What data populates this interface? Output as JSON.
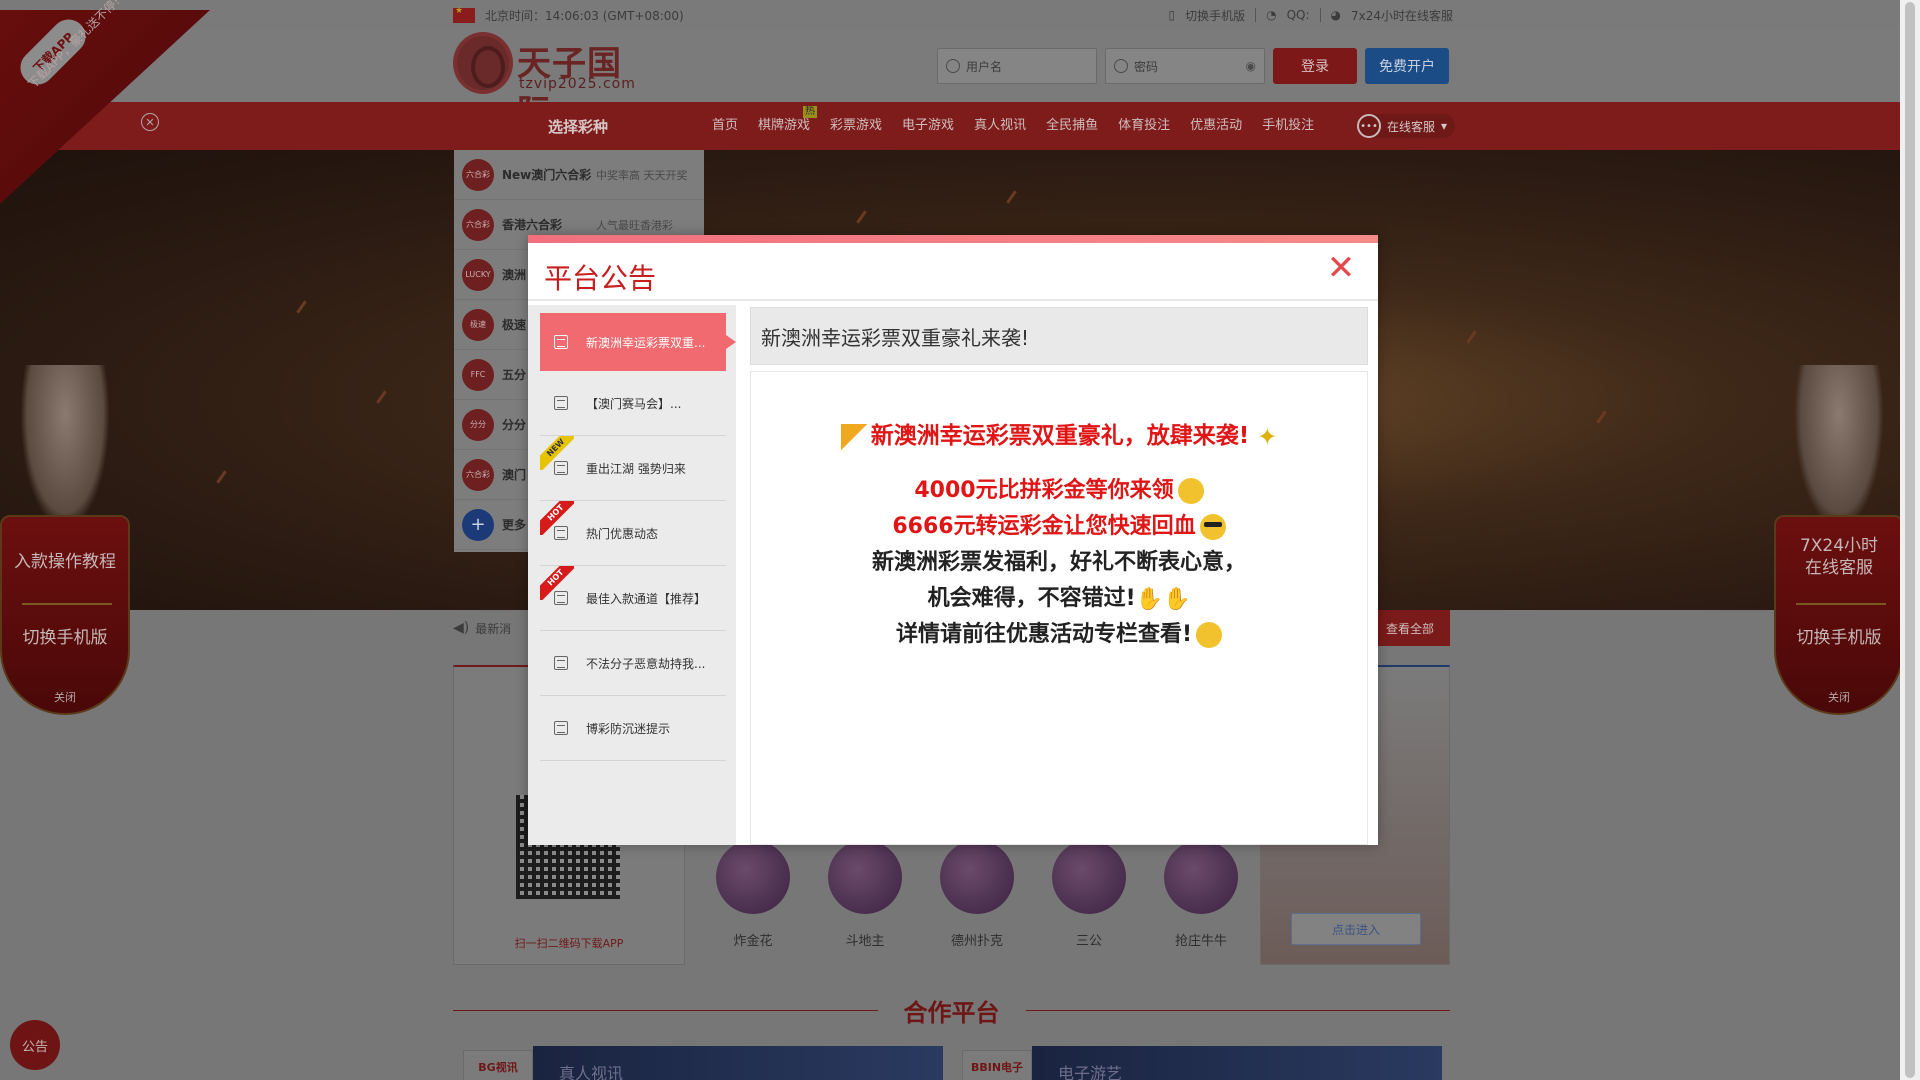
{
  "topbar": {
    "beijing_time": "北京时间：14:06:03 (GMT+08:00)",
    "switch_mobile": "切换手机版",
    "qq": "QQ:",
    "service_247": "7x24小时在线客服"
  },
  "header": {
    "logo_title": "天子国际",
    "logo_url": "tzvip2025.com",
    "username_placeholder": "用户名",
    "password_placeholder": "密码",
    "login_label": "登录",
    "register_label": "免费开户"
  },
  "nav": {
    "pick_lottery": "选择彩种",
    "items": [
      "首页",
      "棋牌游戏",
      "彩票游戏",
      "电子游戏",
      "真人视讯",
      "全民捕鱼",
      "体育投注",
      "优惠活动",
      "手机投注"
    ],
    "hot_badge": "热",
    "service": "在线客服"
  },
  "lottery_list": [
    {
      "icon": "六合彩",
      "name": "New澳门六合彩",
      "desc": "中奖率高 天天开奖"
    },
    {
      "icon": "六合彩",
      "name": "香港六合彩",
      "desc": "人气最旺香港彩"
    },
    {
      "icon": "LUCKY",
      "name": "澳洲",
      "desc": ""
    },
    {
      "icon": "极速",
      "name": "极速",
      "desc": ""
    },
    {
      "icon": "FFC",
      "name": "五分",
      "desc": ""
    },
    {
      "icon": "分分",
      "name": "分分",
      "desc": ""
    },
    {
      "icon": "六合彩",
      "name": "澳门",
      "desc": ""
    }
  ],
  "lottery_more": {
    "icon": "+",
    "name": "更多"
  },
  "news": {
    "prefix": "最新消",
    "view_all": "查看全部"
  },
  "app_box": {
    "qr_caption": "扫一扫二维码下载APP"
  },
  "games": [
    "炸金花",
    "斗地主",
    "德州扑克",
    "三公",
    "抢庄牛牛"
  ],
  "enter_box": {
    "enter_label": "点击进入"
  },
  "partners": {
    "title": "合作平台",
    "items": [
      {
        "tag": "BG视讯",
        "caption": "真人视讯"
      },
      {
        "tag": "BBIN电子",
        "caption": "电子游艺"
      }
    ]
  },
  "corner_app": {
    "pill": "下载APP",
    "slogan": "下载APP，豪礼送不停!"
  },
  "float_left": {
    "line1": "入款操作教程",
    "line2": "切换手机版",
    "close": "关闭"
  },
  "float_right": {
    "line1": "7X24小时\n在线客服",
    "line2": "切换手机版",
    "close": "关闭"
  },
  "notice_fab": "公告",
  "modal": {
    "title": "平台公告",
    "tabs": [
      {
        "label": "新澳洲幸运彩票双重...",
        "badge": ""
      },
      {
        "label": "【澳门赛马会】...",
        "badge": ""
      },
      {
        "label": "重出江湖 强势归来",
        "badge": "NEW"
      },
      {
        "label": "热门优惠动态",
        "badge": "HOT"
      },
      {
        "label": "最佳入款通道【推荐】",
        "badge": "HOT"
      },
      {
        "label": "不法分子恶意劫持我...",
        "badge": ""
      },
      {
        "label": "博彩防沉迷提示",
        "badge": ""
      }
    ],
    "content_title": "新澳洲幸运彩票双重豪礼来袭!",
    "lines": [
      "新澳洲幸运彩票双重豪礼，放肆来袭!",
      "4000元比拼彩金等你来领",
      "6666元转运彩金让您快速回血",
      "新澳洲彩票发福利，好礼不断表心意，",
      "机会难得，不容错过!",
      "详情请前往优惠活动专栏查看!"
    ]
  }
}
